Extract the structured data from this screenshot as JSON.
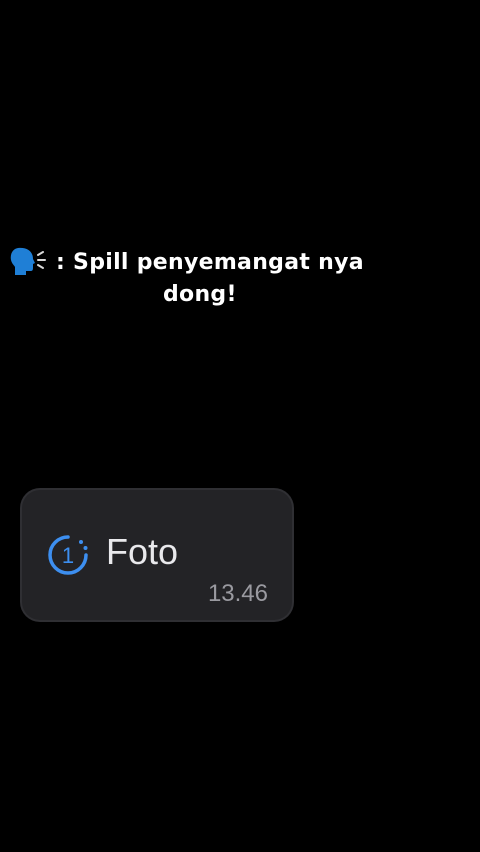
{
  "caption": {
    "icon": "speaking-head-icon",
    "icon_color": "#1f7fd6",
    "line1": ": Spill penyemangat nya",
    "line2": "dong!"
  },
  "message": {
    "icon": "view-once-icon",
    "icon_glyph": "1",
    "icon_color": "#3d8ff0",
    "label": "Foto",
    "time": "13.46",
    "bubble_color": "#232326"
  }
}
